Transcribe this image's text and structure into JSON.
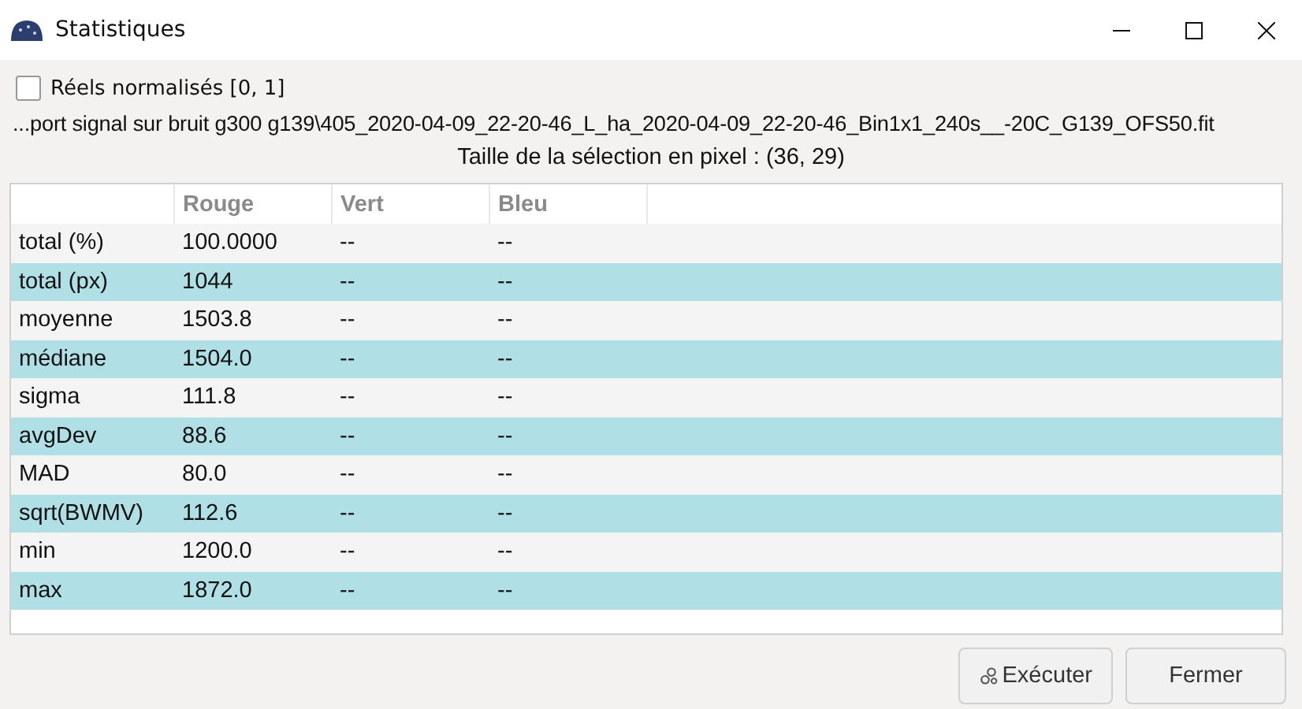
{
  "window": {
    "title": "Statistiques"
  },
  "normalize_checkbox": {
    "label": "Réels normalisés [0, 1]",
    "checked": false
  },
  "file_path": "...port signal sur bruit g300 g139\\405_2020-04-09_22-20-46_L_ha_2020-04-09_22-20-46_Bin1x1_240s__-20C_G139_OFS50.fit",
  "selection_size": "Taille de la sélection en pixel : (36, 29)",
  "table": {
    "columns": [
      "Rouge",
      "Vert",
      "Bleu"
    ],
    "rows": [
      {
        "label": "total (%)",
        "values": [
          "100.0000",
          "--",
          "--"
        ]
      },
      {
        "label": "total (px)",
        "values": [
          "1044",
          "--",
          "--"
        ]
      },
      {
        "label": "moyenne",
        "values": [
          "1503.8",
          "--",
          "--"
        ]
      },
      {
        "label": "médiane",
        "values": [
          "1504.0",
          "--",
          "--"
        ]
      },
      {
        "label": "sigma",
        "values": [
          "111.8",
          "--",
          "--"
        ]
      },
      {
        "label": "avgDev",
        "values": [
          "88.6",
          "--",
          "--"
        ]
      },
      {
        "label": "MAD",
        "values": [
          "80.0",
          "--",
          "--"
        ]
      },
      {
        "label": "sqrt(BWMV)",
        "values": [
          "112.6",
          "--",
          "--"
        ]
      },
      {
        "label": "min",
        "values": [
          "1200.0",
          "--",
          "--"
        ]
      },
      {
        "label": "max",
        "values": [
          "1872.0",
          "--",
          "--"
        ]
      }
    ]
  },
  "buttons": [
    {
      "kind": "execute",
      "label": "Exécuter"
    },
    {
      "kind": "close",
      "label": "Fermer"
    }
  ]
}
